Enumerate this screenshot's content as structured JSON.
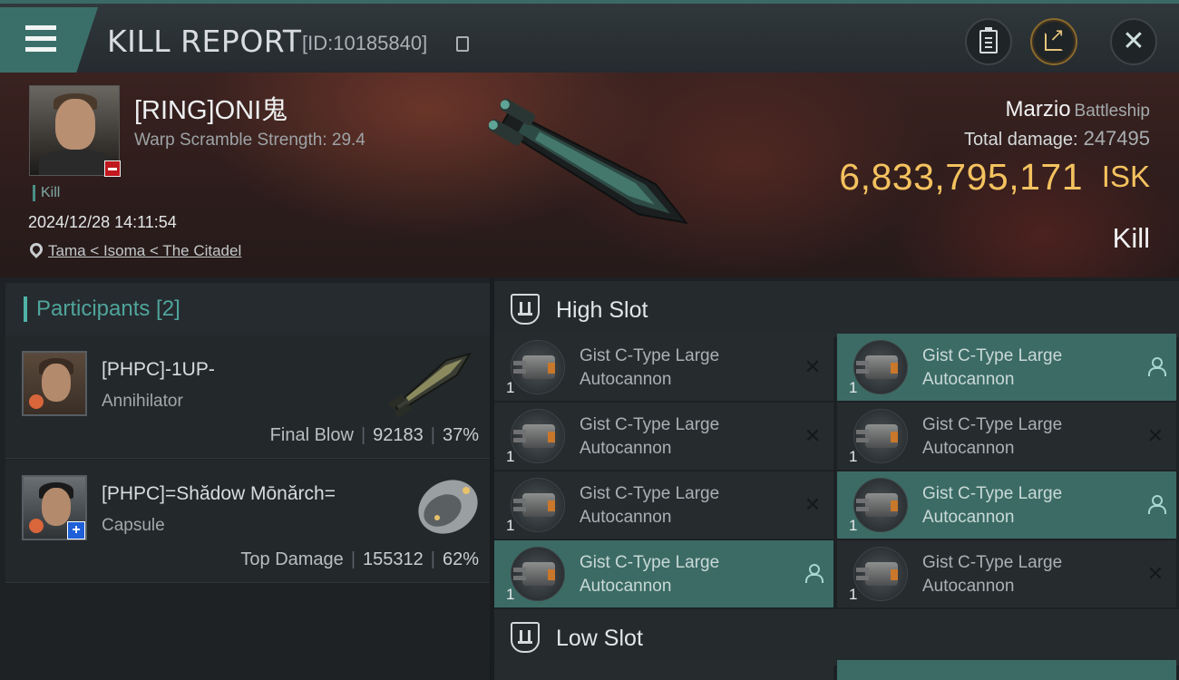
{
  "header": {
    "title": "KILL REPORT",
    "report_id": "[ID:10185840]",
    "icons": [
      "menu-icon",
      "copy-icon",
      "clipboard-icon",
      "share-icon",
      "close-icon"
    ]
  },
  "victim": {
    "name": "[RING]ONI鬼",
    "warp_scramble": "Warp Scramble Strength: 29.4",
    "tag": "Kill",
    "datetime": "2024/12/28 14:11:54",
    "location": "Tama < Isoma < The Citadel"
  },
  "ship": {
    "name": "Marzio",
    "class": "Battleship",
    "damage_label": "Total damage:",
    "damage_value": "247495",
    "isk_value": "6,833,795,171",
    "isk_unit": "ISK",
    "result": "Kill"
  },
  "participants": {
    "title": "Participants [2]",
    "items": [
      {
        "name": "[PHPC]-1UP-",
        "ship": "Annihilator",
        "role": "Final Blow",
        "damage": "92183",
        "percent": "37%"
      },
      {
        "name": "[PHPC]=Shădow Mōnărch=",
        "ship": "Capsule",
        "role": "Top Damage",
        "damage": "155312",
        "percent": "62%"
      }
    ]
  },
  "slots": {
    "high": {
      "title": "High Slot",
      "modules": [
        {
          "qty": "1",
          "line1": "Gist C-Type Large",
          "line2": "Autocannon",
          "state": "destroyed"
        },
        {
          "qty": "1",
          "line1": "Gist C-Type Large",
          "line2": "Autocannon",
          "state": "dropped"
        },
        {
          "qty": "1",
          "line1": "Gist C-Type Large",
          "line2": "Autocannon",
          "state": "destroyed"
        },
        {
          "qty": "1",
          "line1": "Gist C-Type Large",
          "line2": "Autocannon",
          "state": "destroyed"
        },
        {
          "qty": "1",
          "line1": "Gist C-Type Large",
          "line2": "Autocannon",
          "state": "destroyed"
        },
        {
          "qty": "1",
          "line1": "Gist C-Type Large",
          "line2": "Autocannon",
          "state": "dropped"
        },
        {
          "qty": "1",
          "line1": "Gist C-Type Large",
          "line2": "Autocannon",
          "state": "dropped"
        },
        {
          "qty": "1",
          "line1": "Gist C-Type Large",
          "line2": "Autocannon",
          "state": "destroyed"
        }
      ]
    },
    "low": {
      "title": "Low Slot"
    }
  },
  "colors": {
    "accent_teal": "#4fb3a8",
    "isk_gold": "#f4c25f",
    "negative_red": "#c0181e"
  }
}
